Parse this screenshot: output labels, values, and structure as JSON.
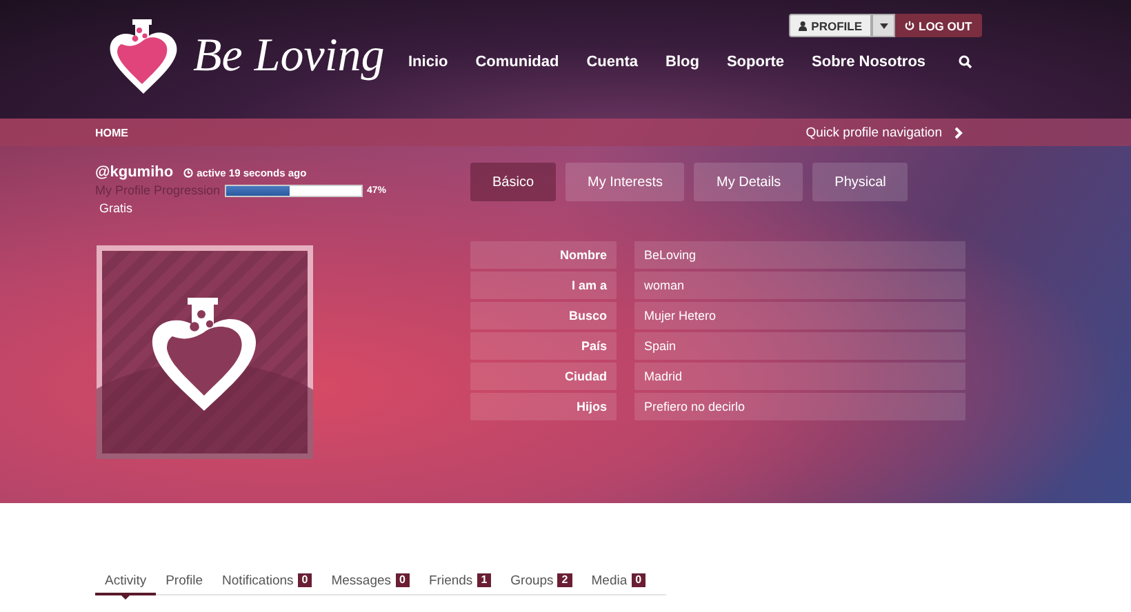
{
  "logo": {
    "text": "Be Loving"
  },
  "account_buttons": {
    "profile": "PROFILE",
    "logout": "LOG OUT"
  },
  "nav": [
    "Inicio",
    "Comunidad",
    "Cuenta",
    "Blog",
    "Soporte",
    "Sobre Nosotros"
  ],
  "breadcrumb": {
    "home": "HOME",
    "quick_nav": "Quick profile navigation"
  },
  "profile": {
    "username": "@kgumiho",
    "activity": "active 19 seconds ago",
    "progress_label": "My Profile Progression",
    "level": 0.47,
    "reading": "47%",
    "plan": "Gratis"
  },
  "profile_tabs": [
    {
      "label": "Básico",
      "selected": true
    },
    {
      "label": "My Interests",
      "selected": false
    },
    {
      "label": "My Details",
      "selected": false
    },
    {
      "label": "Physical",
      "selected": false
    }
  ],
  "fields": [
    {
      "label": "Nombre",
      "value": "BeLoving"
    },
    {
      "label": "I am a",
      "value": "woman"
    },
    {
      "label": "Busco",
      "value": "Mujer Hetero"
    },
    {
      "label": "País",
      "value": "Spain"
    },
    {
      "label": "Ciudad",
      "value": "Madrid"
    },
    {
      "label": "Hijos",
      "value": "Prefiero no decirlo"
    }
  ],
  "sub_tabs": [
    {
      "label": "Activity",
      "selected": true
    },
    {
      "label": "Profile",
      "selected": false
    },
    {
      "label": "Notifications",
      "count": "0",
      "selected": false
    },
    {
      "label": "Messages",
      "count": "0",
      "selected": false
    },
    {
      "label": "Friends",
      "count": "1",
      "selected": false
    },
    {
      "label": "Groups",
      "count": "2",
      "selected": false
    },
    {
      "label": "Media",
      "count": "0",
      "selected": false
    }
  ]
}
